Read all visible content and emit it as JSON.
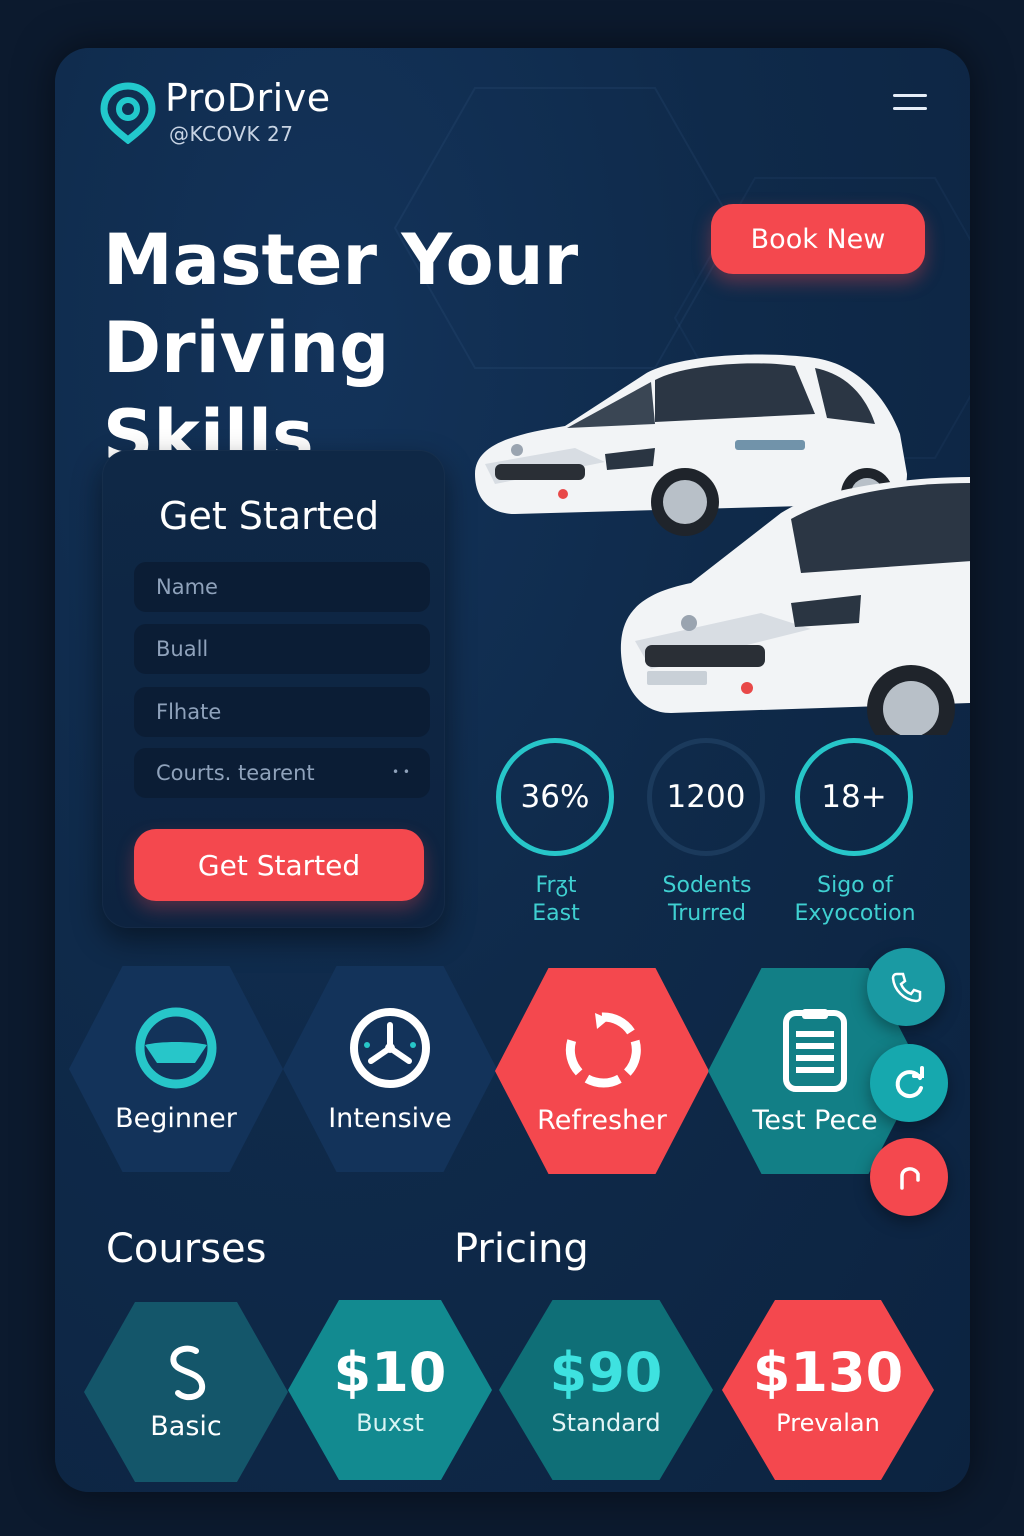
{
  "brand": {
    "name": "ProDrive",
    "tagline": "@KCOVK 27"
  },
  "hero": {
    "title_line1": "Master Your",
    "title_line2": "Driving Skills",
    "book_label": "Book New"
  },
  "form": {
    "title": "Get Started",
    "fields": [
      {
        "placeholder": "Name"
      },
      {
        "placeholder": "Buall"
      },
      {
        "placeholder": "Flhate"
      },
      {
        "placeholder": "Courts. tearent"
      }
    ],
    "submit_label": "Get Started"
  },
  "stats": [
    {
      "value": "36%",
      "label_line1": "Frᵹt",
      "label_line2": "East"
    },
    {
      "value": "1200",
      "label_line1": "Sodents",
      "label_line2": "Trurred"
    },
    {
      "value": "18+",
      "label_line1": "Sigo of",
      "label_line2": "Exyocotion"
    }
  ],
  "courses": [
    {
      "label": "Beginner",
      "icon": "steering-wheel-icon"
    },
    {
      "label": "Intensive",
      "icon": "dashboard-icon"
    },
    {
      "label": "Refresher",
      "icon": "refresh-icon"
    },
    {
      "label": "Test Pece",
      "icon": "clipboard-icon"
    }
  ],
  "fabs": [
    {
      "icon": "phone-icon"
    },
    {
      "icon": "sync-icon"
    },
    {
      "icon": "arrow-icon"
    }
  ],
  "sections": {
    "courses": "Courses",
    "pricing": "Pricing"
  },
  "pricing": [
    {
      "price": "",
      "name": "Basic",
      "icon": "s-curve-icon"
    },
    {
      "price": "$10",
      "name": "Buxst"
    },
    {
      "price": "$90",
      "name": "Standard"
    },
    {
      "price": "$130",
      "name": "Prevalan"
    }
  ],
  "colors": {
    "accent": "#f4484e",
    "teal": "#27c6c9",
    "navy": "#0f2a4a"
  }
}
